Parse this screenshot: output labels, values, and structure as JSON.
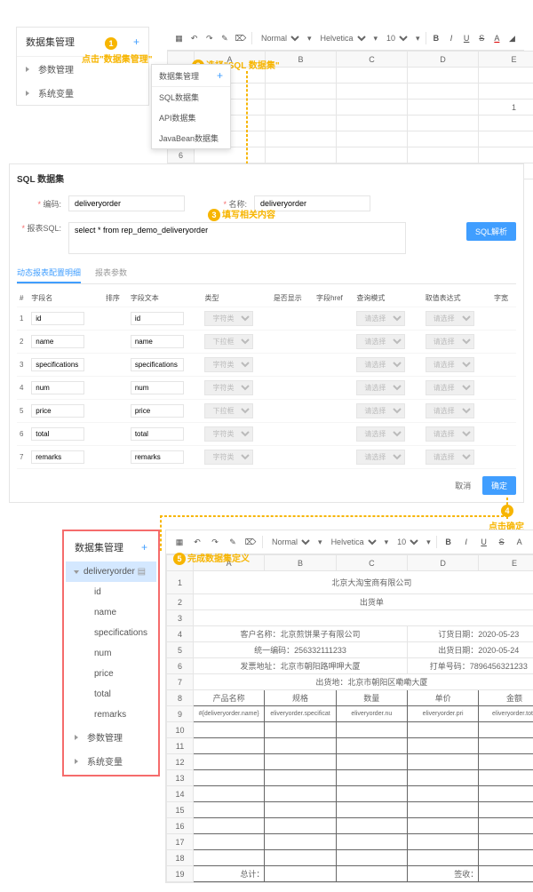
{
  "sidebar": {
    "dataset_mgmt": "数据集管理",
    "param_mgmt": "参数管理",
    "sys_var": "系统变量"
  },
  "dropdown": {
    "header": "数据集管理",
    "sql": "SQL数据集",
    "api": "API数据集",
    "javabean": "JavaBean数据集"
  },
  "toolbar": {
    "normal": "Normal",
    "font": "Helvetica",
    "size": "10"
  },
  "ann": {
    "a1": "点击\"数据集管理\"",
    "a2": "选择\"SQL 数据集\"",
    "a3": "填写相关内容",
    "a4": "点击确定",
    "a5": "完成数据集定义"
  },
  "cell_val": "1",
  "dialog": {
    "title": "SQL 数据集",
    "code_label": "编码:",
    "code_val": "deliveryorder",
    "name_label": "名称:",
    "name_val": "deliveryorder",
    "sql_label": "报表SQL:",
    "sql_val": "select * from rep_demo_deliveryorder",
    "parse_btn": "SQL解析",
    "tab1": "动态报表配置明细",
    "tab2": "报表参数",
    "cols": {
      "idx": "#",
      "fname": "字段名",
      "order": "排序",
      "ftext": "字段文本",
      "type": "类型",
      "dict": "是否显示",
      "href": "字段href",
      "qmode": "查询模式",
      "expr": "取值表达式",
      "w": "字宽"
    },
    "rows": [
      {
        "i": "1",
        "n": "id",
        "t": "id",
        "ty": "字符类型"
      },
      {
        "i": "2",
        "n": "name",
        "t": "name",
        "ty": "下拉框型"
      },
      {
        "i": "3",
        "n": "specifications",
        "t": "specifications",
        "ty": "字符类型"
      },
      {
        "i": "4",
        "n": "num",
        "t": "num",
        "ty": "字符类型"
      },
      {
        "i": "5",
        "n": "price",
        "t": "price",
        "ty": "下拉框型"
      },
      {
        "i": "6",
        "n": "total",
        "t": "total",
        "ty": "字符类型"
      },
      {
        "i": "7",
        "n": "remarks",
        "t": "remarks",
        "ty": "字符类型"
      }
    ],
    "cancel": "取消",
    "ok": "确定"
  },
  "result": {
    "ds": "deliveryorder",
    "fields": [
      "id",
      "name",
      "specifications",
      "num",
      "price",
      "total",
      "remarks"
    ]
  },
  "doc": {
    "title": "北京大淘宝商有限公司",
    "sub": "出货单",
    "r1a": "客户名称：北京煎饼果子有限公司",
    "r1b": "订货日期：2020-05-23",
    "r2a": "统一编码：256332111233",
    "r2b": "出货日期：2020-05-24",
    "r3a": "发票地址：北京市朝阳路呷呷大厦",
    "r3b": "打单号码：7896456321233",
    "r4": "出货地：北京市朝阳区嘞嘞大厦",
    "h": [
      "产品名称",
      "规格",
      "数量",
      "单价",
      "金额"
    ],
    "expr": [
      "#{deliveryorder.name}",
      "eliveryorder.specificat",
      "eliveryorder.nu",
      "eliveryorder.pri",
      "eliveryorder.tota"
    ],
    "sum": "总计：",
    "sign": "签收："
  }
}
